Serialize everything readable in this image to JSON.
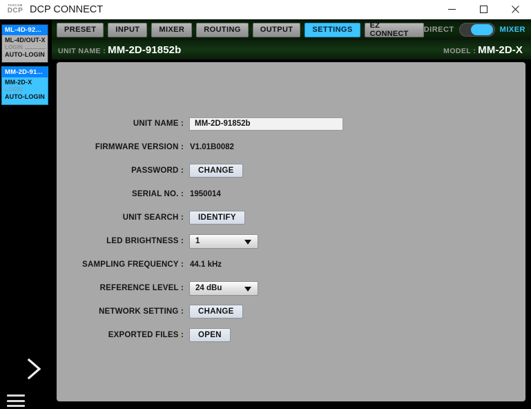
{
  "window": {
    "title": "DCP CONNECT",
    "logo_brand": "TASCAM",
    "logo_product": "DCP",
    "minimize_icon": "minimize-icon",
    "maximize_icon": "maximize-icon",
    "close_icon": "close-icon"
  },
  "sidebar": {
    "units": [
      {
        "name": "ML-4D-92...",
        "model": "ML-4D/OUT-X",
        "login": "LOGIN",
        "auto_login": "AUTO-LOGIN",
        "selected": false
      },
      {
        "name": "MM-2D-91...",
        "model": "MM-2D-X",
        "login": "LOGIN",
        "auto_login": "AUTO-LOGIN",
        "selected": true
      }
    ],
    "expand_icon": "chevron-right-icon",
    "menu_icon": "hamburger-menu-icon"
  },
  "tabs": [
    {
      "label": "PRESET",
      "active": false
    },
    {
      "label": "INPUT",
      "active": false
    },
    {
      "label": "MIXER",
      "active": false
    },
    {
      "label": "ROUTING",
      "active": false
    },
    {
      "label": "OUTPUT",
      "active": false
    },
    {
      "label": "SETTINGS",
      "active": true
    },
    {
      "label": "EZ CONNECT",
      "active": false
    }
  ],
  "mode_toggle": {
    "left_label": "DIRECT",
    "right_label": "MIXER",
    "state": "MIXER"
  },
  "unit_header": {
    "unit_name_label": "UNIT NAME :",
    "unit_name_value": "MM-2D-91852b",
    "model_label": "MODEL :",
    "model_value": "MM-2D-X"
  },
  "settings": {
    "rows": [
      {
        "label": "UNIT NAME :",
        "type": "text",
        "value": "MM-2D-91852b"
      },
      {
        "label": "FIRMWARE VERSION :",
        "type": "static",
        "value": "V1.01B0082"
      },
      {
        "label": "PASSWORD :",
        "type": "button",
        "value": "CHANGE"
      },
      {
        "label": "SERIAL NO. :",
        "type": "static",
        "value": "1950014"
      },
      {
        "label": "UNIT SEARCH :",
        "type": "button",
        "value": "IDENTIFY"
      },
      {
        "label": "LED BRIGHTNESS :",
        "type": "select",
        "value": "1"
      },
      {
        "label": "SAMPLING FREQUENCY :",
        "type": "static",
        "value": "44.1 kHz"
      },
      {
        "label": "REFERENCE LEVEL :",
        "type": "select",
        "value": "24 dBu"
      },
      {
        "label": "NETWORK SETTING :",
        "type": "button",
        "value": "CHANGE"
      },
      {
        "label": "EXPORTED FILES :",
        "type": "button",
        "value": "OPEN"
      }
    ]
  },
  "colors": {
    "accent_cyan": "#3ec4ff",
    "selected_blue": "#0a84ff",
    "header_green": "#143614",
    "panel_grey": "#a8a8a8"
  }
}
